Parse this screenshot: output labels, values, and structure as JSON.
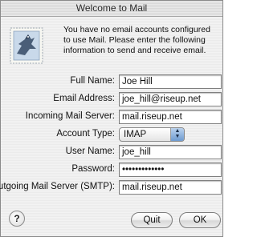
{
  "window": {
    "title": "Welcome to Mail"
  },
  "intro_text": "You have no email accounts configured to use Mail. Please enter the following information to send and receive email.",
  "form": {
    "full_name": {
      "label": "Full Name:",
      "value": "Joe Hill"
    },
    "email_address": {
      "label": "Email Address:",
      "value": "joe_hill@riseup.net"
    },
    "incoming_server": {
      "label": "Incoming Mail Server:",
      "value": "mail.riseup.net"
    },
    "account_type": {
      "label": "Account Type:",
      "value": "IMAP"
    },
    "user_name": {
      "label": "User Name:",
      "value": "joe_hill"
    },
    "password": {
      "label": "Password:",
      "value": "•••••••••••••"
    },
    "outgoing_server": {
      "label": "Outgoing Mail Server (SMTP):",
      "value": "mail.riseup.net"
    }
  },
  "buttons": {
    "help": "?",
    "quit": "Quit",
    "ok": "OK"
  },
  "icons": {
    "app": "mail-stamp-icon",
    "select_arrows": "up-down-arrows-icon"
  },
  "colors": {
    "select_arrow_blue": "#6e9bd0",
    "window_bg": "#eeeeee"
  }
}
